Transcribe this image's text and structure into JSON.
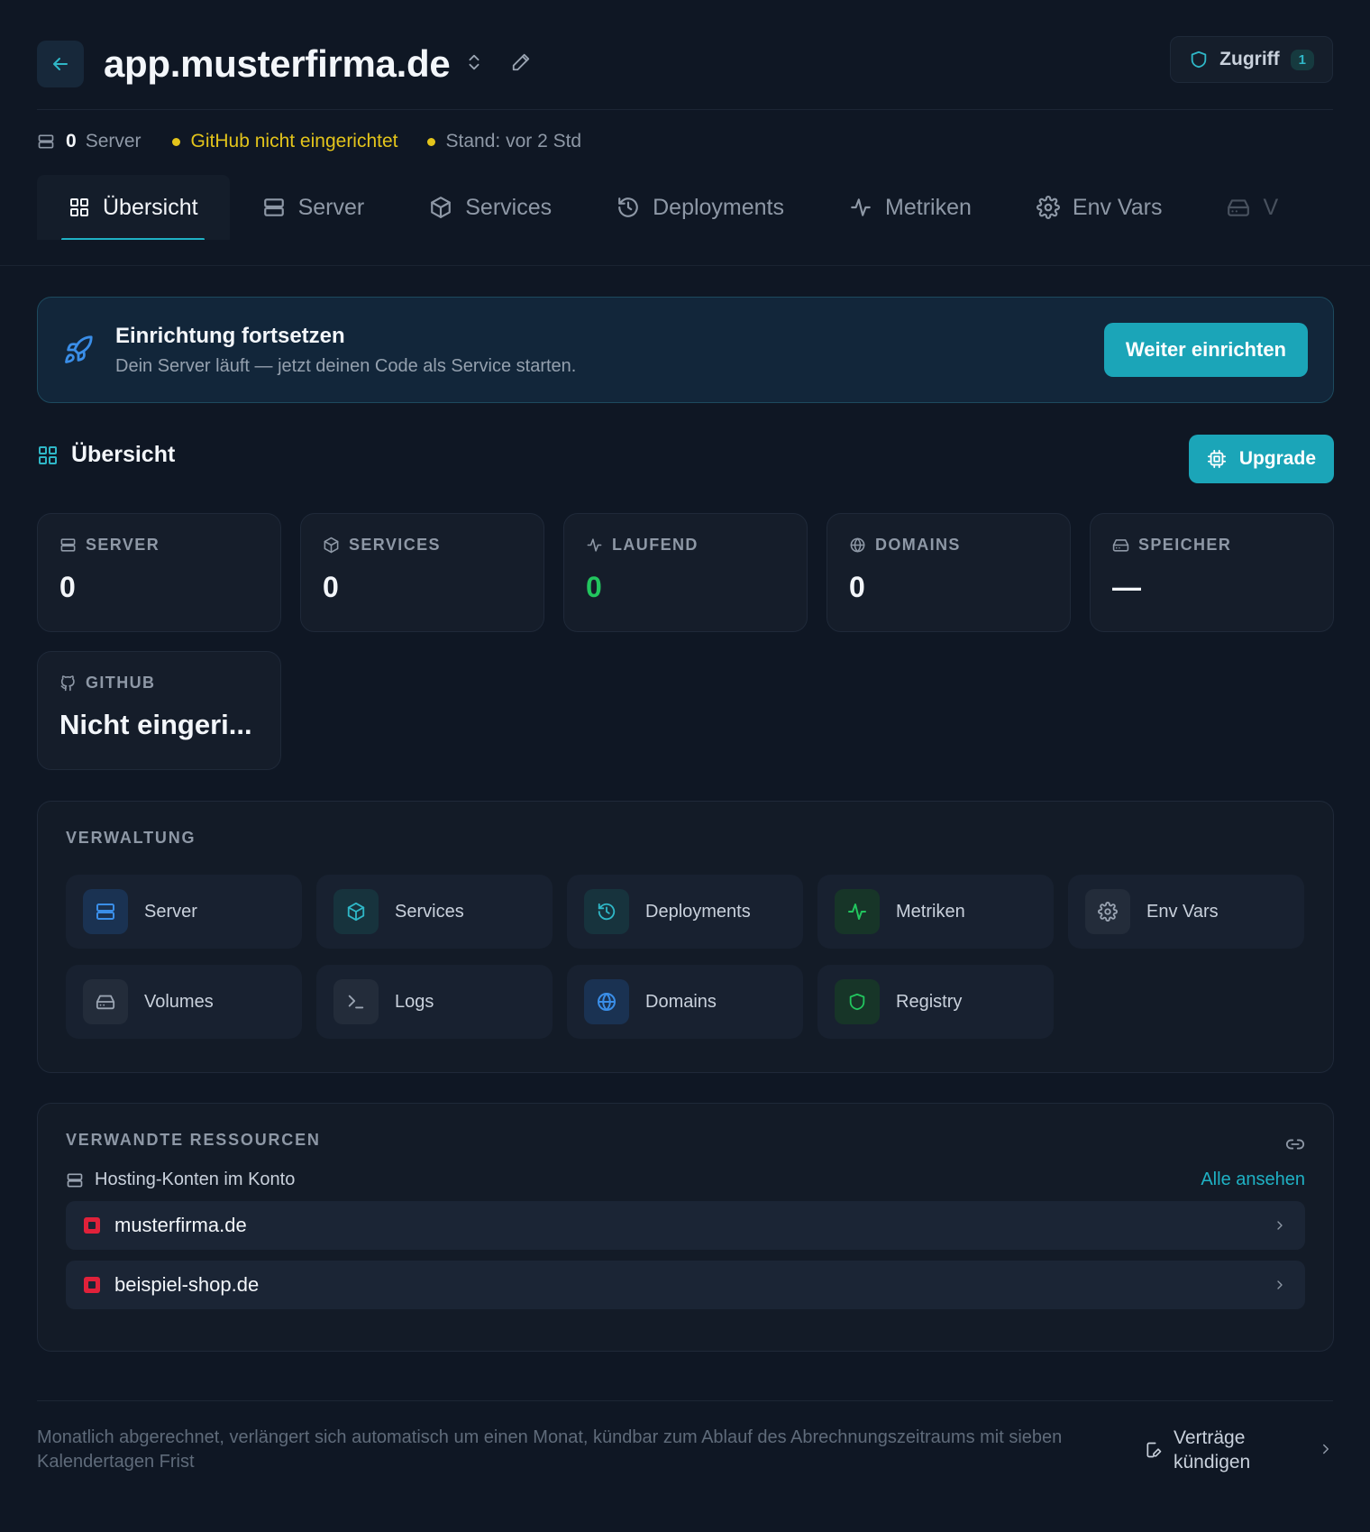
{
  "header": {
    "title": "app.musterfirma.de",
    "access_label": "Zugriff",
    "access_count": "1"
  },
  "status": {
    "server_count": "0",
    "server_label": "Server",
    "github_status": "GitHub nicht eingerichtet",
    "stand": "Stand: vor 2 Std"
  },
  "tabs": [
    {
      "label": "Übersicht",
      "icon": "grid-icon",
      "active": true
    },
    {
      "label": "Server",
      "icon": "server-icon"
    },
    {
      "label": "Services",
      "icon": "box-icon"
    },
    {
      "label": "Deployments",
      "icon": "history-icon"
    },
    {
      "label": "Metriken",
      "icon": "activity-icon"
    },
    {
      "label": "Env Vars",
      "icon": "gear-icon"
    },
    {
      "label": "V",
      "icon": "drive-icon"
    }
  ],
  "banner": {
    "title": "Einrichtung fortsetzen",
    "subtitle": "Dein Server läuft — jetzt deinen Code als Service starten.",
    "button": "Weiter einrichten"
  },
  "overview": {
    "title": "Übersicht",
    "upgrade": "Upgrade"
  },
  "stats": [
    {
      "label": "SERVER",
      "value": "0",
      "icon": "server-icon"
    },
    {
      "label": "SERVICES",
      "value": "0",
      "icon": "box-icon"
    },
    {
      "label": "LAUFEND",
      "value": "0",
      "icon": "activity-icon",
      "color": "#22c55e"
    },
    {
      "label": "DOMAINS",
      "value": "0",
      "icon": "globe-icon"
    },
    {
      "label": "SPEICHER",
      "value": "—",
      "icon": "drive-icon"
    },
    {
      "label": "GITHUB",
      "value": "Nicht eingeri...",
      "icon": "github-icon"
    }
  ],
  "verwaltung": {
    "title": "VERWALTUNG",
    "items": [
      {
        "label": "Server",
        "icon": "server-icon",
        "color": "#3a8ee8"
      },
      {
        "label": "Services",
        "icon": "box-icon",
        "color": "#2fb7c7"
      },
      {
        "label": "Deployments",
        "icon": "history-icon",
        "color": "#2fb7c7"
      },
      {
        "label": "Metriken",
        "icon": "activity-icon",
        "color": "#22c55e"
      },
      {
        "label": "Env Vars",
        "icon": "gear-icon",
        "color": "#9aa4b2"
      },
      {
        "label": "Volumes",
        "icon": "drive-icon",
        "color": "#9aa4b2"
      },
      {
        "label": "Logs",
        "icon": "terminal-icon",
        "color": "#9aa4b2"
      },
      {
        "label": "Domains",
        "icon": "globe-icon",
        "color": "#3a8ee8"
      },
      {
        "label": "Registry",
        "icon": "shield-icon",
        "color": "#22c55e"
      }
    ]
  },
  "ressourcen": {
    "title": "VERWANDTE RESSOURCEN",
    "group_label": "Hosting-Konten im Konto",
    "all_label": "Alle ansehen",
    "items": [
      {
        "label": "musterfirma.de"
      },
      {
        "label": "beispiel-shop.de"
      }
    ]
  },
  "footer": {
    "text": "Monatlich abgerechnet, verlängert sich automatisch um einen Monat, kündbar zum Ablauf des Abrechnungszeitraums mit sieben Kalendertagen Frist",
    "cancel_label": "Verträge kündigen"
  },
  "colors": {
    "accent": "#1ba5b8",
    "warning": "#e3c41b",
    "success": "#22c55e",
    "background": "#0f1724"
  }
}
